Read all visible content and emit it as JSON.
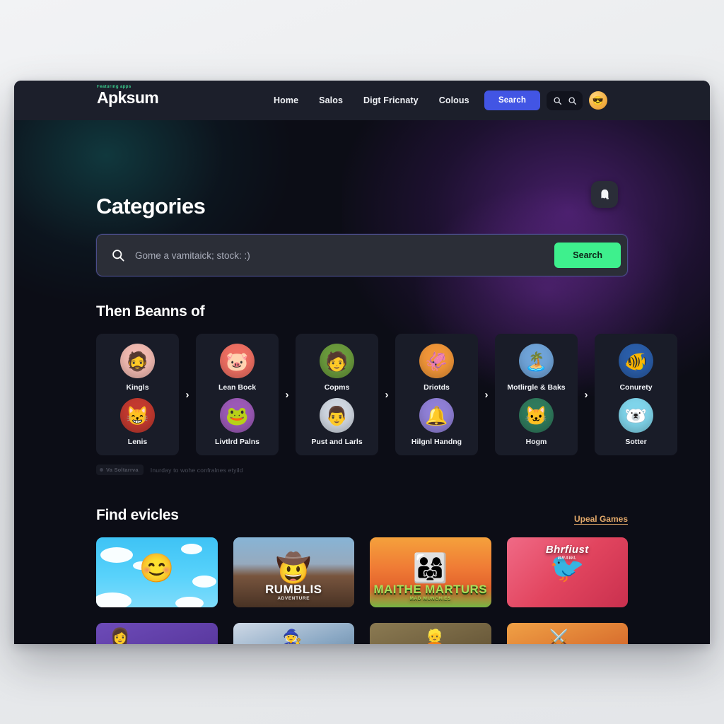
{
  "header": {
    "logo_kicker": "Featuring apps",
    "logo_text": "Apksum",
    "nav": [
      {
        "label": "Home"
      },
      {
        "label": "Salos"
      },
      {
        "label": "Digt Fricnaty"
      },
      {
        "label": "Colous"
      }
    ],
    "search_button": "Search",
    "icons": {
      "search_1": "search-icon",
      "search_2": "search-icon",
      "avatar": "user-avatar"
    },
    "avatar_glyph": "😎",
    "accent_blue": "#4255e4"
  },
  "hero": {
    "title": "Categories",
    "fab_icon": "ghost-icon"
  },
  "search": {
    "placeholder": "Gome a vamitaick; stock: :)",
    "value": "",
    "submit_label": "Search",
    "submit_color": "#3ef08d",
    "icon": "magnifier-icon"
  },
  "categories": {
    "title": "Then Beanns of",
    "chevron": "›",
    "cards": [
      {
        "top": {
          "label": "Kingls",
          "emoji": "🧔",
          "bg": "#f0b9b0"
        },
        "bottom": {
          "label": "Lenis",
          "emoji": "😸",
          "bg": "#c2392f"
        }
      },
      {
        "top": {
          "label": "Lean Bock",
          "emoji": "🐷",
          "bg": "#ee6f62"
        },
        "bottom": {
          "label": "Livtlrd Palns",
          "emoji": "🐸",
          "bg": "#9b59b6"
        }
      },
      {
        "top": {
          "label": "Copms",
          "emoji": "🧑",
          "bg": "#6a9a3c"
        },
        "bottom": {
          "label": "Pust and Larls",
          "emoji": "👨",
          "bg": "#cfd6e0"
        }
      },
      {
        "top": {
          "label": "Driotds",
          "emoji": "🦑",
          "bg": "#f09538"
        },
        "bottom": {
          "label": "Hilgnl Handng",
          "emoji": "🔔",
          "bg": "#8f7fd6"
        }
      },
      {
        "top": {
          "label": "Motlirgle & Baks",
          "emoji": "🏝️",
          "bg": "#6fa3d8"
        },
        "bottom": {
          "label": "Hogm",
          "emoji": "🐱",
          "bg": "#2f7a5c"
        }
      },
      {
        "top": {
          "label": "Conurety",
          "emoji": "🐠",
          "bg": "#2a5da8"
        },
        "bottom": {
          "label": "Sotter",
          "emoji": "🐻‍❄️",
          "bg": "#7fd4ea"
        }
      }
    ],
    "note_badge": "Va Soltarrva",
    "note_text": "Inurday to wohe confralnes etyild"
  },
  "games": {
    "title": "Find evicles",
    "link": "Upeal Games",
    "cards": [
      {
        "title": "",
        "subtitle": "",
        "emoji": "😊"
      },
      {
        "title": "RUMBLIS",
        "subtitle": "ADVENTURE",
        "emoji": "🤠"
      },
      {
        "title": "MAITHE MARTURS",
        "subtitle": "MAD MUNCHIES",
        "emoji": "👨‍👩‍👧"
      },
      {
        "title": "Bhrfiust",
        "subtitle": "BRAWL",
        "emoji": "🐦"
      }
    ],
    "cards_row2": [
      {
        "emoji": "👩"
      },
      {
        "emoji": "🧙"
      },
      {
        "emoji": "👱"
      },
      {
        "emoji": "⚔️"
      }
    ]
  }
}
